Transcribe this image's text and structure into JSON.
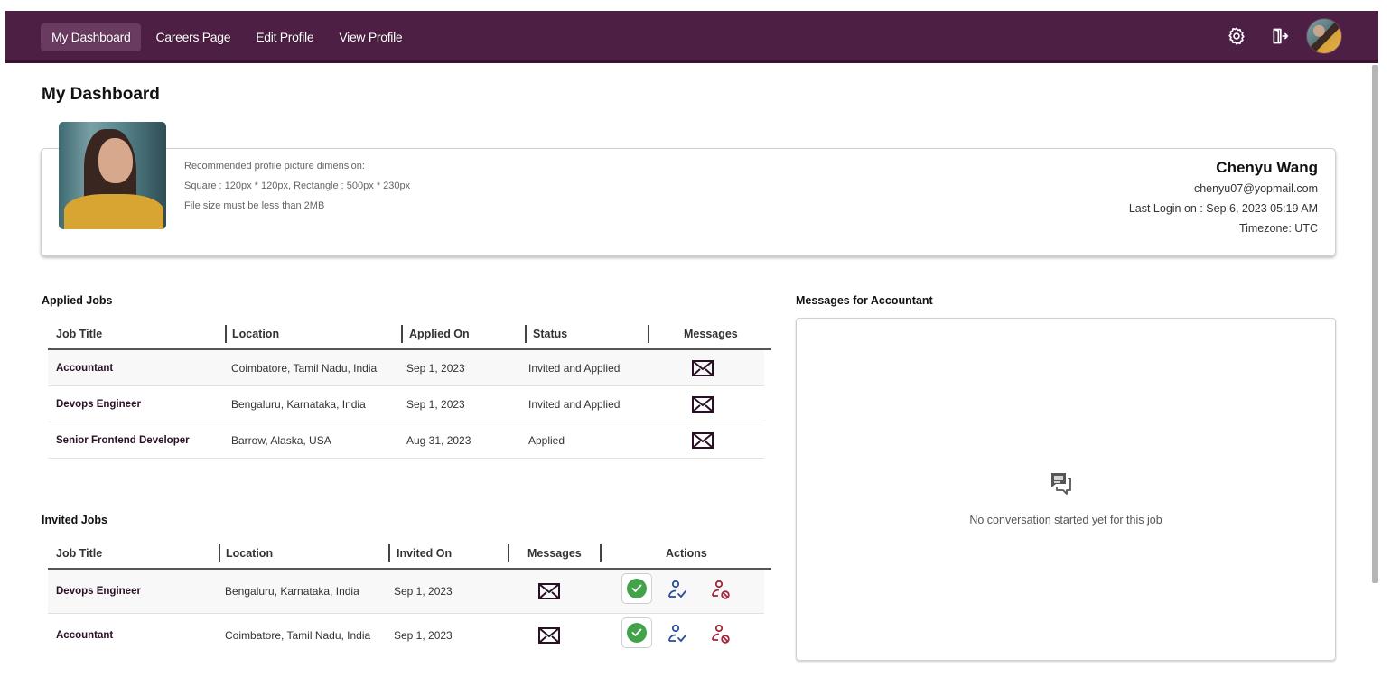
{
  "nav": {
    "links": [
      {
        "label": "My Dashboard",
        "active": true
      },
      {
        "label": "Careers Page",
        "active": false
      },
      {
        "label": "Edit Profile",
        "active": false
      },
      {
        "label": "View Profile",
        "active": false
      }
    ],
    "icons": [
      "gear-icon",
      "logout-icon",
      "avatar"
    ],
    "brand_color": "#4e1f44"
  },
  "page": {
    "title": "My Dashboard"
  },
  "profile": {
    "hints": [
      "Recommended profile picture dimension:",
      "Square : 120px * 120px, Rectangle : 500px * 230px",
      "File size must be less than 2MB"
    ],
    "name": "Chenyu Wang",
    "email": "chenyu07@yopmail.com",
    "last_login": "Last Login on : Sep 6, 2023 05:19 AM",
    "timezone": "Timezone: UTC"
  },
  "applied_jobs": {
    "label": "Applied Jobs",
    "columns": [
      "Job Title",
      "Location",
      "Applied On",
      "Status",
      "Messages"
    ],
    "rows": [
      {
        "title": "Accountant",
        "location": "Coimbatore, Tamil Nadu, India",
        "date": "Sep 1, 2023",
        "status": "Invited and Applied",
        "message_icon": "mail-icon"
      },
      {
        "title": "Devops Engineer",
        "location": "Bengaluru, Karnataka, India",
        "date": "Sep 1, 2023",
        "status": "Invited and Applied",
        "message_icon": "mail-icon"
      },
      {
        "title": "Senior Frontend Developer",
        "location": "Barrow, Alaska, USA",
        "date": "Aug 31, 2023",
        "status": "Applied",
        "message_icon": "mail-icon"
      }
    ]
  },
  "invited_jobs": {
    "label": "Invited Jobs",
    "columns": [
      "Job Title",
      "Location",
      "Invited On",
      "Messages",
      "Actions"
    ],
    "rows": [
      {
        "title": "Devops Engineer",
        "location": "Bengaluru, Karnataka, India",
        "date": "Sep 1, 2023",
        "message_icon": "mail-icon",
        "actions": [
          "accepted-check-icon",
          "user-check-icon",
          "user-block-icon"
        ]
      },
      {
        "title": "Accountant",
        "location": "Coimbatore, Tamil Nadu, India",
        "date": "Sep 1, 2023",
        "message_icon": "mail-icon",
        "actions": [
          "accepted-check-icon",
          "user-check-icon",
          "user-block-icon"
        ]
      }
    ],
    "colors": {
      "accept": "#43a34a",
      "approve": "#2a4f9c",
      "reject": "#a3263a"
    }
  },
  "messages": {
    "label": "Messages for Accountant",
    "empty_text": "No conversation started yet for this job",
    "icon": "chat-icon"
  }
}
